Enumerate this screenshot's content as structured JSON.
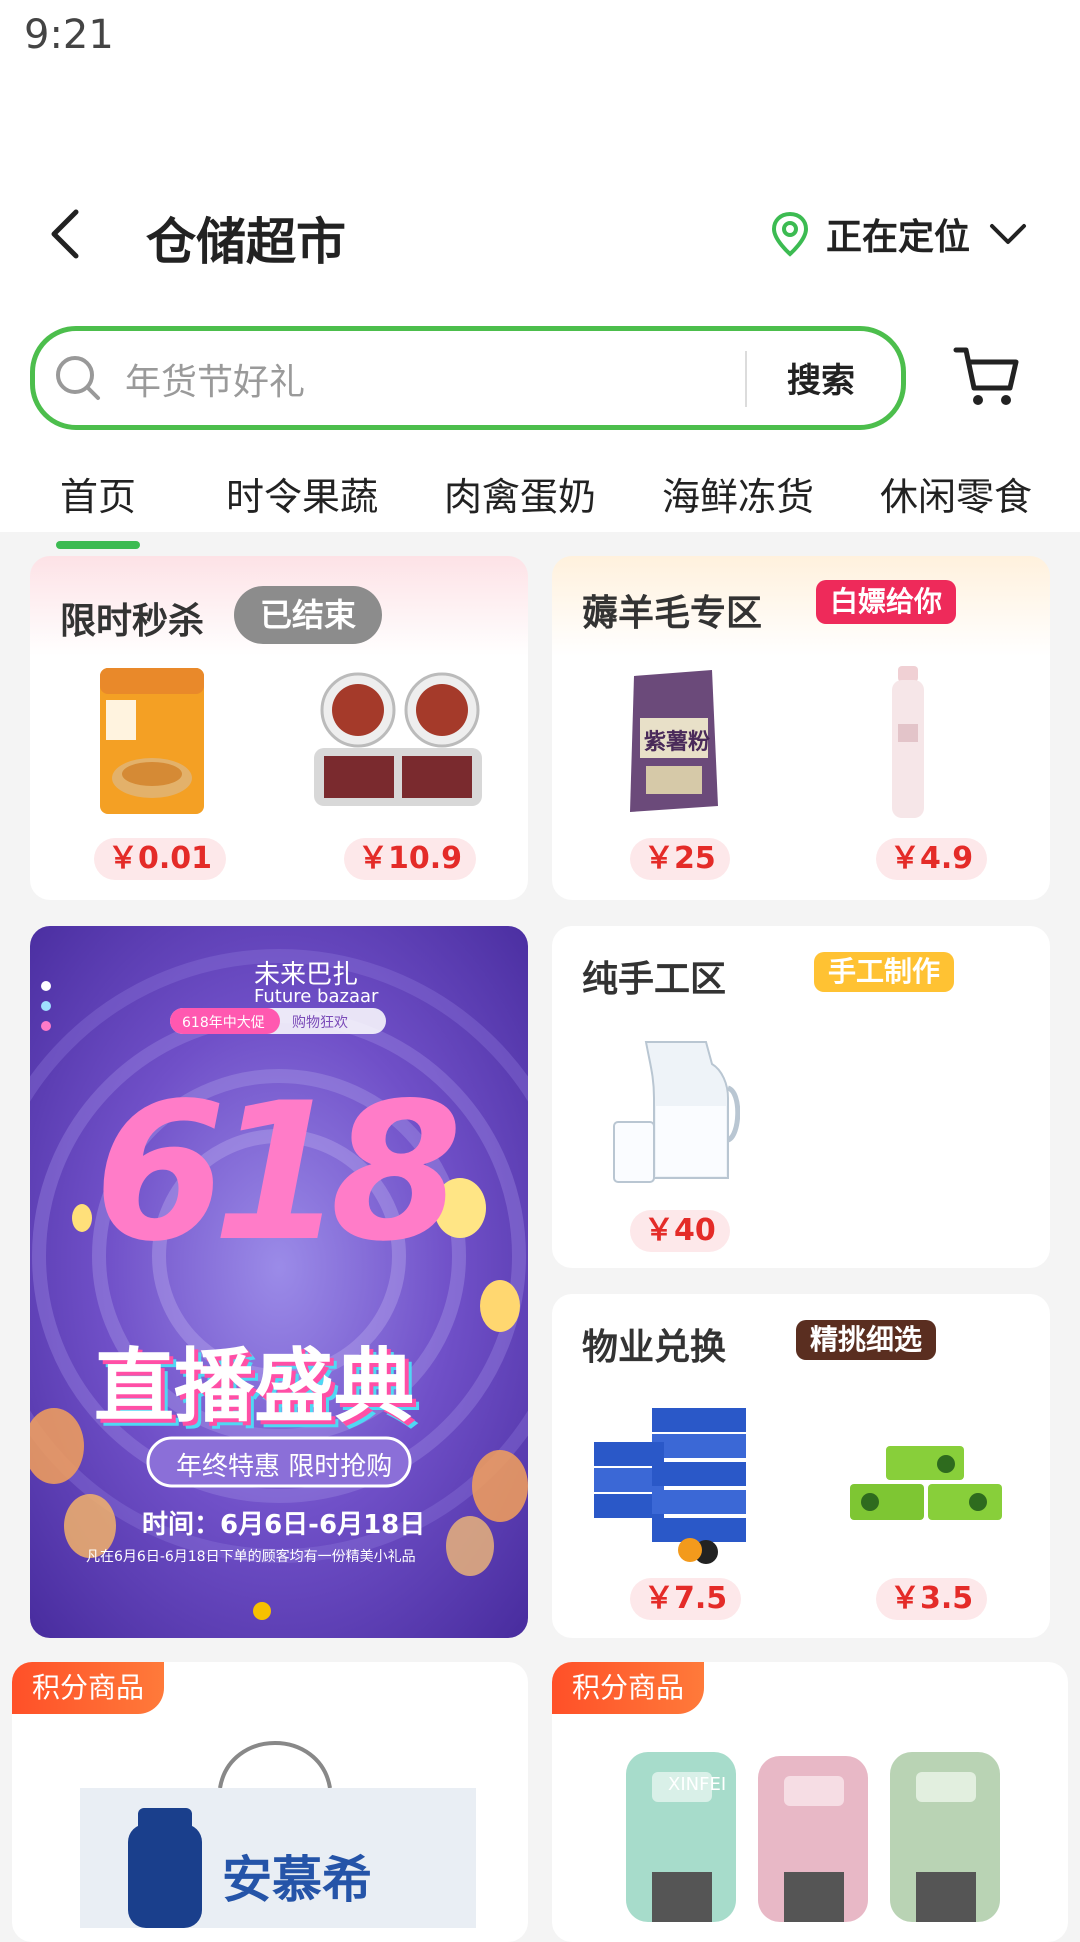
{
  "status_bar": {
    "time": "9:21"
  },
  "header": {
    "title": "仓储超市",
    "location_label": "正在定位"
  },
  "search": {
    "placeholder": "年货节好礼",
    "button": "搜索"
  },
  "tabs": [
    "首页",
    "时令果蔬",
    "肉禽蛋奶",
    "海鲜冻货",
    "休闲零食"
  ],
  "flash_sale": {
    "title": "限时秒杀",
    "badge": "已结束",
    "prices": [
      "￥0.01",
      "￥10.9"
    ]
  },
  "wool_zone": {
    "title": "薅羊毛专区",
    "badge": "白嫖给你",
    "prices": [
      "￥25",
      "￥4.9"
    ],
    "product_text": "紫薯粉"
  },
  "handmade": {
    "title": "纯手工区",
    "badge": "手工制作",
    "prices": [
      "￥40"
    ]
  },
  "property": {
    "title": "物业兑换",
    "badge": "精挑细选",
    "prices": [
      "￥7.5",
      "￥3.5"
    ]
  },
  "banner": {
    "brand_cn": "未来巴扎",
    "brand_en": "Future bazaar",
    "chip_left": "618年中大促",
    "chip_right": "购物狂欢",
    "big_number": "618",
    "headline": "直播盛典",
    "subline": "年终特惠 限时抢购",
    "date_line": "时间：6月6日-6月18日",
    "fine_print": "凡在6月6日-6月18日下单的顾客均有一份精美小礼品"
  },
  "points_items": [
    {
      "badge": "积分商品",
      "brand": "安慕希"
    },
    {
      "badge": "积分商品",
      "brand": "XINFEI"
    }
  ],
  "colors": {
    "accent_green": "#3cbb52",
    "price_red": "#e42b28"
  }
}
